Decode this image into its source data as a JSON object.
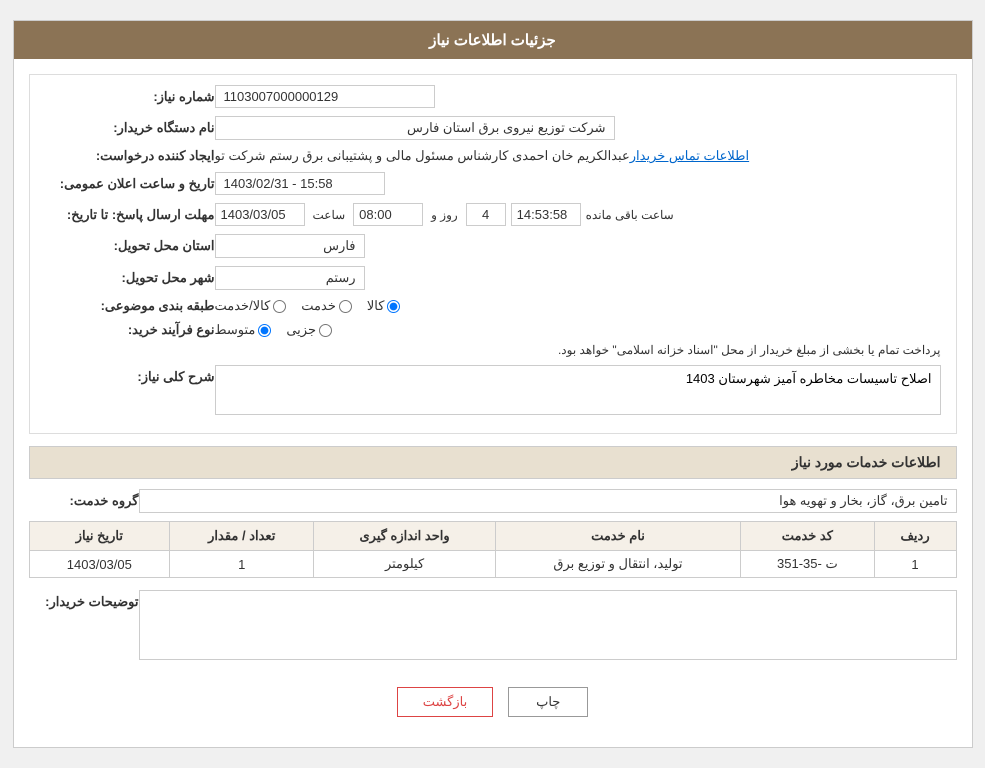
{
  "header": {
    "title": "جزئیات اطلاعات نیاز"
  },
  "fields": {
    "need_number_label": "شماره نیاز:",
    "need_number_value": "1103007000000129",
    "buyer_org_label": "نام دستگاه خریدار:",
    "buyer_org_value": "شرکت توزیع نیروی برق استان فارس",
    "announce_label": "تاریخ و ساعت اعلان عمومی:",
    "announce_value": "1403/02/31 - 15:58",
    "creator_label": "ایجاد کننده درخواست:",
    "creator_value": "عبدالکریم خان احمدی کارشناس مسئول مالی و پشتیبانی برق رستم شرکت تو",
    "contact_link": "اطلاعات تماس خریدار",
    "deadline_label": "مهلت ارسال پاسخ: تا تاریخ:",
    "deadline_date": "1403/03/05",
    "deadline_time_label": "ساعت",
    "deadline_time": "08:00",
    "deadline_days_label": "روز و",
    "deadline_days": "4",
    "deadline_remaining_label": "ساعت باقی مانده",
    "deadline_remaining": "14:53:58",
    "province_label": "استان محل تحویل:",
    "province_value": "فارس",
    "city_label": "شهر محل تحویل:",
    "city_value": "رستم",
    "classification_label": "طبقه بندی موضوعی:",
    "classification_options": [
      "کالا",
      "خدمت",
      "کالا/خدمت"
    ],
    "classification_selected": "کالا",
    "process_label": "نوع فرآیند خرید:",
    "process_options": [
      "جزیی",
      "متوسط"
    ],
    "process_selected": "متوسط",
    "process_note": "پرداخت تمام یا بخشی از مبلغ خریدار از محل \"اسناد خزانه اسلامی\" خواهد بود.",
    "description_label": "شرح کلی نیاز:",
    "description_value": "اصلاح تاسیسات مخاطره آمیز شهرستان 1403"
  },
  "services_section": {
    "section_title": "اطلاعات خدمات مورد نیاز",
    "service_group_label": "گروه خدمت:",
    "service_group_value": "تامین برق، گاز، بخار و تهویه هوا",
    "table": {
      "headers": [
        "ردیف",
        "کد خدمت",
        "نام خدمت",
        "واحد اندازه گیری",
        "تعداد / مقدار",
        "تاریخ نیاز"
      ],
      "rows": [
        {
          "row_num": "1",
          "service_code": "ت -35-351",
          "service_name": "تولید، انتقال و توزیع برق",
          "unit": "کیلومتر",
          "quantity": "1",
          "date": "1403/03/05"
        }
      ]
    }
  },
  "buyer_notes": {
    "label": "توضیحات خریدار:",
    "value": ""
  },
  "buttons": {
    "print": "چاپ",
    "back": "بازگشت"
  }
}
